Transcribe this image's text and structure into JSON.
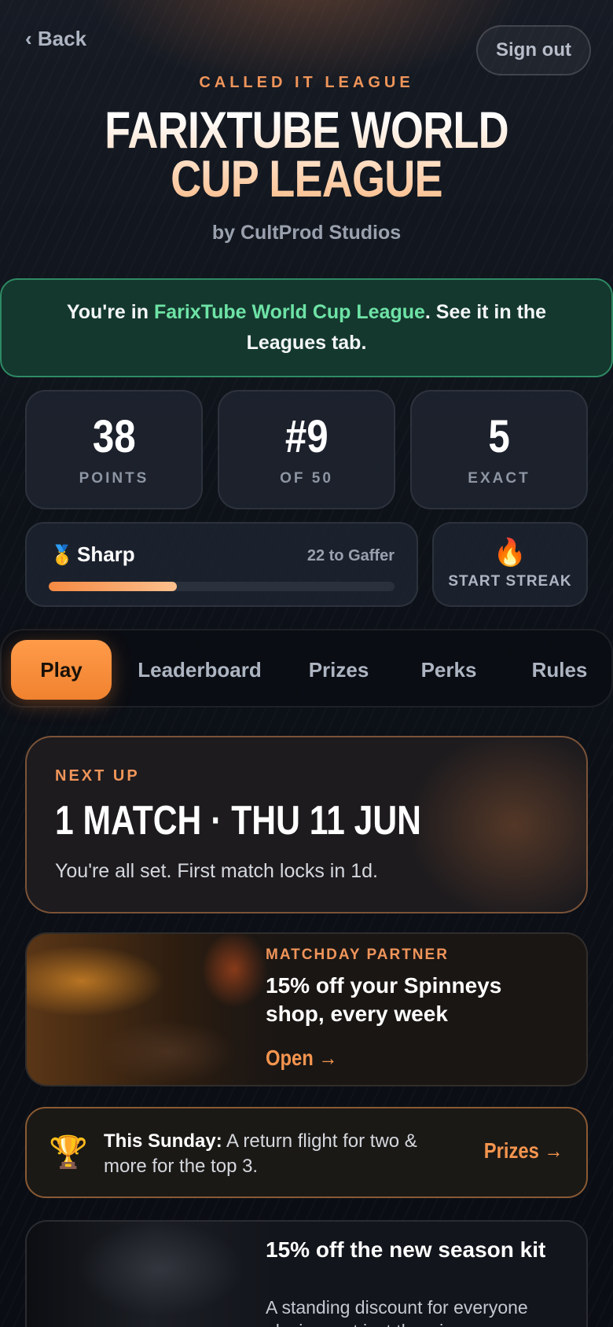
{
  "header": {
    "back_label": "‹ Back",
    "signout_label": "Sign out",
    "eyebrow": "CALLED IT LEAGUE",
    "title": "FARIXTUBE WORLD CUP LEAGUE",
    "byline": "by CultProd Studios"
  },
  "joined": {
    "prefix": "You're in ",
    "league": "FarixTube World Cup League",
    "suffix": ". See it in the Leagues tab."
  },
  "stats": [
    {
      "value": "38",
      "label": "POINTS"
    },
    {
      "value": "#9",
      "label": "OF 50"
    },
    {
      "value": "5",
      "label": "EXACT"
    }
  ],
  "rank": {
    "medal_icon": "medal-icon",
    "name": "Sharp",
    "next": "22 to Gaffer",
    "progress_percent": 37
  },
  "streak": {
    "icon": "fire-icon",
    "label": "START STREAK"
  },
  "tabs": [
    {
      "label": "Play",
      "active": true
    },
    {
      "label": "Leaderboard",
      "active": false
    },
    {
      "label": "Prizes",
      "active": false
    },
    {
      "label": "Perks",
      "active": false
    },
    {
      "label": "Rules",
      "active": false
    }
  ],
  "next_up": {
    "eyebrow": "NEXT UP",
    "headline": "1 MATCH · THU 11 JUN",
    "sub": "You're all set. First match locks in 1d."
  },
  "partner": {
    "eyebrow": "MATCHDAY PARTNER",
    "headline": "15% off your Spinneys shop, every week",
    "cta": "Open →"
  },
  "prize_note": {
    "icon": "trophy-icon",
    "lead": "This Sunday:",
    "text": " A return flight for two & more for the top 3.",
    "cta": "Prizes →"
  },
  "kit": {
    "headline": "15% off the new season kit",
    "sub": "A standing discount for everyone playing, not just the winners."
  },
  "colors": {
    "accent": "#f5954f",
    "success": "#6ee3a6",
    "background": "#0b0f17"
  }
}
